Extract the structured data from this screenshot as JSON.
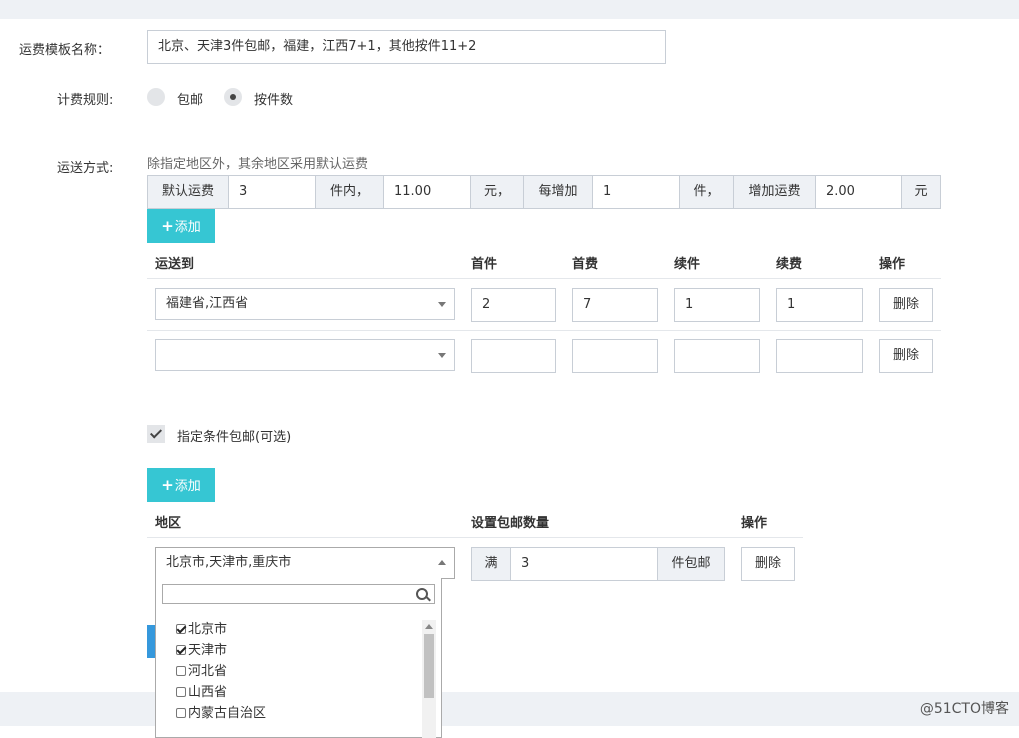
{
  "template_name": {
    "label": "运费模板名称：",
    "value": "北京、天津3件包邮，福建，江西7+1，其他按件11+2"
  },
  "billing_rule": {
    "label": "计费规则:",
    "options": [
      "包邮",
      "按件数"
    ],
    "selected": "按件数"
  },
  "shipping": {
    "label": "运送方式:",
    "hint": "除指定地区外，其余地区采用默认运费",
    "default_fee": {
      "label1": "默认运费",
      "first_qty": "3",
      "label2": "件内，",
      "first_fee": "11.00",
      "label3": "元，",
      "label4": "每增加",
      "add_qty": "1",
      "label5": "件，",
      "label6": "增加运费",
      "add_fee": "2.00",
      "label7": "元"
    },
    "add_button": "添加",
    "table": {
      "headers": [
        "运送到",
        "首件",
        "首费",
        "续件",
        "续费",
        "操作"
      ],
      "rows": [
        {
          "region": "福建省,江西省",
          "first_qty": "2",
          "first_fee": "7",
          "add_qty": "1",
          "add_fee": "1",
          "action": "删除"
        },
        {
          "region": "",
          "first_qty": "",
          "first_fee": "",
          "add_qty": "",
          "add_fee": "",
          "action": "删除"
        }
      ]
    }
  },
  "free_shipping": {
    "checkbox_label": "指定条件包邮(可选)",
    "checked": true,
    "add_button": "添加",
    "table": {
      "headers": [
        "地区",
        "设置包邮数量",
        "操作"
      ],
      "row": {
        "region": "北京市,天津市,重庆市",
        "prefix": "满",
        "qty": "3",
        "suffix": "件包邮",
        "action": "删除"
      }
    },
    "dropdown": {
      "search_placeholder": "",
      "items": [
        {
          "label": "北京市",
          "checked": true
        },
        {
          "label": "天津市",
          "checked": true
        },
        {
          "label": "河北省",
          "checked": false
        },
        {
          "label": "山西省",
          "checked": false
        },
        {
          "label": "内蒙古自治区",
          "checked": false
        }
      ]
    }
  },
  "watermark": "@51CTO博客",
  "colors": {
    "accent": "#36c6d3",
    "primary": "#3598dc",
    "border": "#c8ced6",
    "addon_bg": "#eef1f5"
  }
}
